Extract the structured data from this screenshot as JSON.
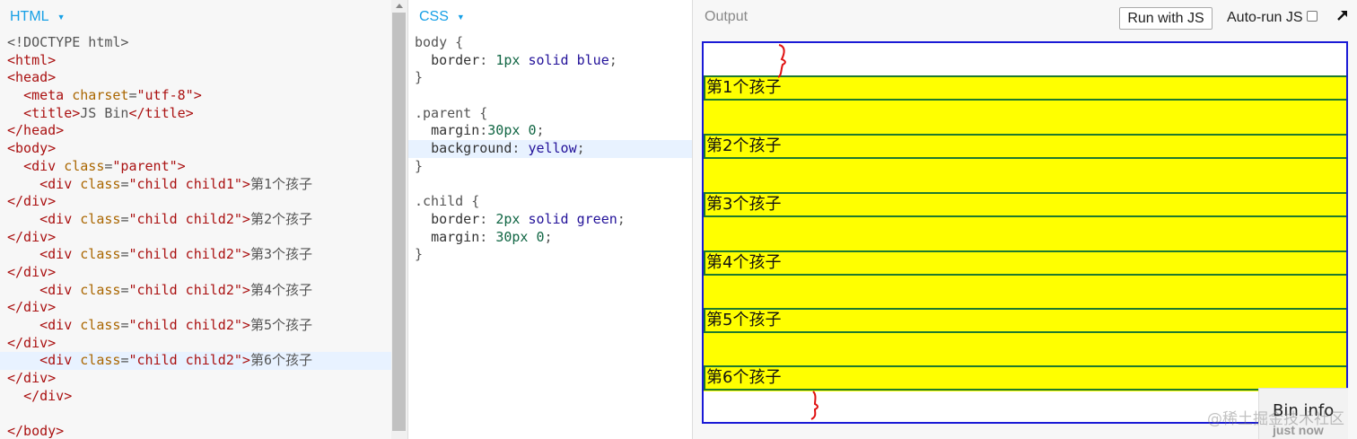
{
  "html_panel": {
    "title": "HTML",
    "caret": "▼",
    "lines": [
      [
        {
          "t": "<!DOCTYPE html>",
          "c": "txt"
        }
      ],
      [
        {
          "t": "<html>",
          "c": "tag"
        }
      ],
      [
        {
          "t": "<head>",
          "c": "tag"
        }
      ],
      [
        {
          "t": "  ",
          "c": "txt"
        },
        {
          "t": "<meta ",
          "c": "tag"
        },
        {
          "t": "charset",
          "c": "attr"
        },
        {
          "t": "=",
          "c": "txt"
        },
        {
          "t": "\"utf-8\"",
          "c": "str"
        },
        {
          "t": ">",
          "c": "tag"
        }
      ],
      [
        {
          "t": "  ",
          "c": "txt"
        },
        {
          "t": "<title>",
          "c": "tag"
        },
        {
          "t": "JS Bin",
          "c": "txt"
        },
        {
          "t": "</title>",
          "c": "tag"
        }
      ],
      [
        {
          "t": "</head>",
          "c": "tag"
        }
      ],
      [
        {
          "t": "<body>",
          "c": "tag"
        }
      ],
      [
        {
          "t": "  ",
          "c": "txt"
        },
        {
          "t": "<div ",
          "c": "tag"
        },
        {
          "t": "class",
          "c": "attr"
        },
        {
          "t": "=",
          "c": "txt"
        },
        {
          "t": "\"parent\"",
          "c": "str"
        },
        {
          "t": ">",
          "c": "tag"
        }
      ],
      [
        {
          "t": "    ",
          "c": "txt"
        },
        {
          "t": "<div ",
          "c": "tag"
        },
        {
          "t": "class",
          "c": "attr"
        },
        {
          "t": "=",
          "c": "txt"
        },
        {
          "t": "\"child child1\"",
          "c": "str"
        },
        {
          "t": ">",
          "c": "tag"
        },
        {
          "t": "第1个孩子",
          "c": "txt"
        }
      ],
      [
        {
          "t": "</div>",
          "c": "tag"
        }
      ],
      [
        {
          "t": "    ",
          "c": "txt"
        },
        {
          "t": "<div ",
          "c": "tag"
        },
        {
          "t": "class",
          "c": "attr"
        },
        {
          "t": "=",
          "c": "txt"
        },
        {
          "t": "\"child child2\"",
          "c": "str"
        },
        {
          "t": ">",
          "c": "tag"
        },
        {
          "t": "第2个孩子",
          "c": "txt"
        }
      ],
      [
        {
          "t": "</div>",
          "c": "tag"
        }
      ],
      [
        {
          "t": "    ",
          "c": "txt"
        },
        {
          "t": "<div ",
          "c": "tag"
        },
        {
          "t": "class",
          "c": "attr"
        },
        {
          "t": "=",
          "c": "txt"
        },
        {
          "t": "\"child child2\"",
          "c": "str"
        },
        {
          "t": ">",
          "c": "tag"
        },
        {
          "t": "第3个孩子",
          "c": "txt"
        }
      ],
      [
        {
          "t": "</div>",
          "c": "tag"
        }
      ],
      [
        {
          "t": "    ",
          "c": "txt"
        },
        {
          "t": "<div ",
          "c": "tag"
        },
        {
          "t": "class",
          "c": "attr"
        },
        {
          "t": "=",
          "c": "txt"
        },
        {
          "t": "\"child child2\"",
          "c": "str"
        },
        {
          "t": ">",
          "c": "tag"
        },
        {
          "t": "第4个孩子",
          "c": "txt"
        }
      ],
      [
        {
          "t": "</div>",
          "c": "tag"
        }
      ],
      [
        {
          "t": "    ",
          "c": "txt"
        },
        {
          "t": "<div ",
          "c": "tag"
        },
        {
          "t": "class",
          "c": "attr"
        },
        {
          "t": "=",
          "c": "txt"
        },
        {
          "t": "\"child child2\"",
          "c": "str"
        },
        {
          "t": ">",
          "c": "tag"
        },
        {
          "t": "第5个孩子",
          "c": "txt"
        }
      ],
      [
        {
          "t": "</div>",
          "c": "tag"
        }
      ],
      [
        {
          "t": "    ",
          "c": "txt"
        },
        {
          "t": "<div ",
          "c": "tag"
        },
        {
          "t": "class",
          "c": "attr"
        },
        {
          "t": "=",
          "c": "txt"
        },
        {
          "t": "\"child child2\"",
          "c": "str"
        },
        {
          "t": ">",
          "c": "tag"
        },
        {
          "t": "第6个孩子",
          "c": "txt"
        }
      ],
      [
        {
          "t": "</div>",
          "c": "tag"
        }
      ],
      [
        {
          "t": "  ",
          "c": "txt"
        },
        {
          "t": "</div>",
          "c": "tag"
        }
      ],
      [
        {
          "t": "",
          "c": "txt"
        }
      ],
      [
        {
          "t": "</body>",
          "c": "tag"
        }
      ]
    ],
    "highlight_line": 18
  },
  "css_panel": {
    "title": "CSS",
    "caret": "▼",
    "lines": [
      [
        {
          "t": "body ",
          "c": "sel"
        },
        {
          "t": "{",
          "c": "txt"
        }
      ],
      [
        {
          "t": "  ",
          "c": "txt"
        },
        {
          "t": "border",
          "c": "prop"
        },
        {
          "t": ": ",
          "c": "txt"
        },
        {
          "t": "1px",
          "c": "num"
        },
        {
          "t": " ",
          "c": "txt"
        },
        {
          "t": "solid",
          "c": "kw"
        },
        {
          "t": " ",
          "c": "txt"
        },
        {
          "t": "blue",
          "c": "kw"
        },
        {
          "t": ";",
          "c": "txt"
        }
      ],
      [
        {
          "t": "}",
          "c": "txt"
        }
      ],
      [
        {
          "t": "",
          "c": "txt"
        }
      ],
      [
        {
          "t": ".parent ",
          "c": "sel"
        },
        {
          "t": "{",
          "c": "txt"
        }
      ],
      [
        {
          "t": "  ",
          "c": "txt"
        },
        {
          "t": "margin",
          "c": "prop"
        },
        {
          "t": ":",
          "c": "txt"
        },
        {
          "t": "30px",
          "c": "num"
        },
        {
          "t": " ",
          "c": "txt"
        },
        {
          "t": "0",
          "c": "num"
        },
        {
          "t": ";",
          "c": "txt"
        }
      ],
      [
        {
          "t": "  ",
          "c": "txt"
        },
        {
          "t": "background",
          "c": "prop"
        },
        {
          "t": ": ",
          "c": "txt"
        },
        {
          "t": "yellow",
          "c": "kw"
        },
        {
          "t": ";",
          "c": "txt"
        }
      ],
      [
        {
          "t": "}",
          "c": "txt"
        }
      ],
      [
        {
          "t": "",
          "c": "txt"
        }
      ],
      [
        {
          "t": ".child ",
          "c": "sel"
        },
        {
          "t": "{",
          "c": "txt"
        }
      ],
      [
        {
          "t": "  ",
          "c": "txt"
        },
        {
          "t": "border",
          "c": "prop"
        },
        {
          "t": ": ",
          "c": "txt"
        },
        {
          "t": "2px",
          "c": "num"
        },
        {
          "t": " ",
          "c": "txt"
        },
        {
          "t": "solid",
          "c": "kw"
        },
        {
          "t": " ",
          "c": "txt"
        },
        {
          "t": "green",
          "c": "kw"
        },
        {
          "t": ";",
          "c": "txt"
        }
      ],
      [
        {
          "t": "  ",
          "c": "txt"
        },
        {
          "t": "margin",
          "c": "prop"
        },
        {
          "t": ": ",
          "c": "txt"
        },
        {
          "t": "30px",
          "c": "num"
        },
        {
          "t": " ",
          "c": "txt"
        },
        {
          "t": "0",
          "c": "num"
        },
        {
          "t": ";",
          "c": "txt"
        }
      ],
      [
        {
          "t": "}",
          "c": "txt"
        }
      ]
    ],
    "highlight_line": 6
  },
  "output_panel": {
    "title": "Output",
    "run_button": "Run with JS",
    "autorun_label": "Auto-run JS",
    "autorun_checked": false,
    "children": [
      "第1个孩子",
      "第2个孩子",
      "第3个孩子",
      "第4个孩子",
      "第5个孩子",
      "第6个孩子"
    ],
    "bin_info_label": "Bin info",
    "bin_info_time": "just now",
    "watermark": "@稀土掘金技术社区",
    "colors": {
      "frame_border": "#1a1ad6",
      "parent_bg": "#ffff00",
      "child_border": "#1f7a2e",
      "annotation": "#e01010"
    }
  }
}
